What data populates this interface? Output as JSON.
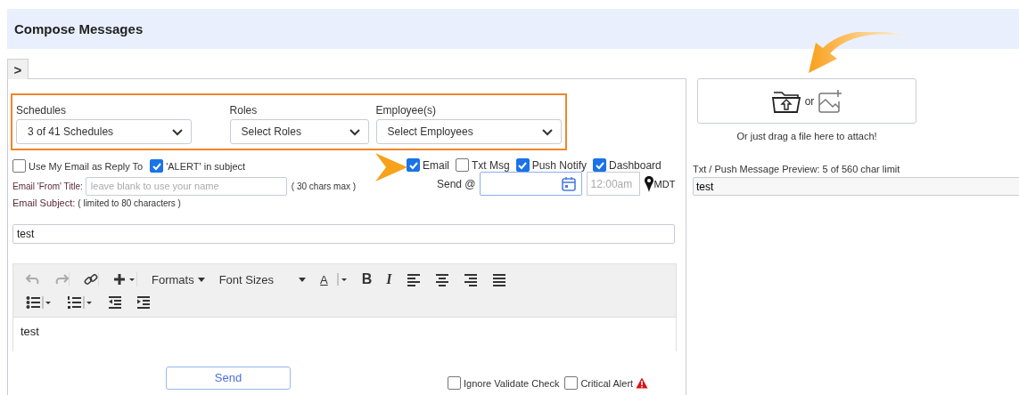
{
  "header": {
    "title": "Compose Messages"
  },
  "toggle": {
    "label": ">"
  },
  "recipients": [
    {
      "label": "Schedules",
      "value": "3 of 41 Schedules"
    },
    {
      "label": "Roles",
      "value": "Select Roles"
    },
    {
      "label": "Employee(s)",
      "value": "Select Employees"
    }
  ],
  "options": [
    {
      "label": "Use My Email as Reply To",
      "checked": false
    },
    {
      "label": "'ALERT' in subject",
      "checked": true
    }
  ],
  "channels": [
    {
      "label": "Email",
      "checked": true
    },
    {
      "label": "Txt Msg",
      "checked": false
    },
    {
      "label": "Push Notify",
      "checked": true
    },
    {
      "label": "Dashboard",
      "checked": true
    }
  ],
  "from_title": {
    "label": "Email 'From' Title:",
    "placeholder": "leave blank to use your name",
    "hint": "( 30 chars max )"
  },
  "send_at": {
    "label": "Send @",
    "time_placeholder": "12:00am",
    "timezone": "MDT"
  },
  "subject": {
    "label": "Email Subject:",
    "hint": "( limited to 80 characters )",
    "value": "test"
  },
  "editor": {
    "undo": {
      "disabled": true
    },
    "redo": {
      "disabled": true
    },
    "formats": "Formats",
    "font_sizes": "Font Sizes",
    "text_color": "A",
    "bold": "B",
    "italic": "I",
    "body": "test"
  },
  "send_button": {
    "label": "Send"
  },
  "footer_options": [
    {
      "label": "Ignore Validate Check",
      "checked": false
    },
    {
      "label": "Critical Alert",
      "checked": false,
      "alert": true
    }
  ],
  "attach": {
    "or": "or",
    "hint": "Or just drag a file here to attach!"
  },
  "preview": {
    "label": "Txt / Push Message Preview: 5 of 560 char limit",
    "value": "test"
  }
}
